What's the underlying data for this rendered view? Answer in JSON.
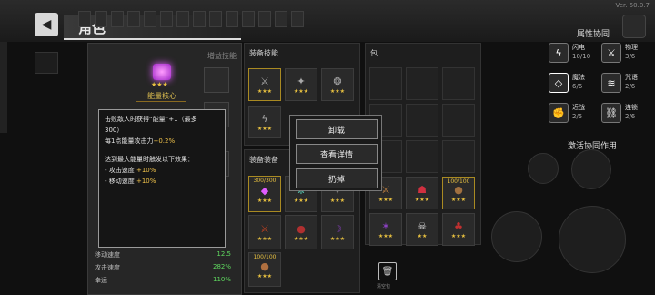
{
  "header": {
    "back_icon": "back-arrow-icon",
    "title": "角色",
    "version": "Ver. 50.0.7"
  },
  "character_panel": {
    "bonus_skill_label": "增益技能",
    "core": {
      "name": "能量核心",
      "icon": "energy-core-icon",
      "stars": "★★★"
    },
    "tooltip": {
      "line1": "击败敌人时获得“能量”+1（最多",
      "line2": "300）",
      "line3a": "每1点能量攻击力",
      "line3b": "+0.2%",
      "line4": "达到最大能量时触发以下效果：",
      "line5a": "- 攻击速度 ",
      "line5b": "+10%",
      "line6a": "- 移动速度 ",
      "line6b": "+10%"
    },
    "stats": [
      {
        "label": "移动速度",
        "value": "12.5"
      },
      {
        "label": "攻击速度",
        "value": "282%"
      },
      {
        "label": "幸运",
        "value": "110%"
      }
    ]
  },
  "equip_skill": {
    "label": "装备技能"
  },
  "equip_gear": {
    "label": "装备装备",
    "energy_count": "300/300",
    "count_a": "100/100"
  },
  "bag": {
    "label": "包",
    "count_b": "100/100"
  },
  "context_menu": {
    "unequip": "卸载",
    "details": "查看详情",
    "discard": "扔掉"
  },
  "trash": {
    "label": "清空包"
  },
  "synergy": {
    "title": "属性协同",
    "activate_label": "激活协同作用",
    "items": [
      {
        "name": "闪电",
        "count": "10/10",
        "icon": "lightning-icon"
      },
      {
        "name": "物理",
        "count": "3/6",
        "icon": "sword-icon"
      },
      {
        "name": "魔法",
        "count": "6/6",
        "icon": "diamond-icon"
      },
      {
        "name": "咒语",
        "count": "2/6",
        "icon": "curse-icon"
      },
      {
        "name": "近战",
        "count": "2/5",
        "icon": "fist-icon"
      },
      {
        "name": "连锁",
        "count": "2/6",
        "icon": "chain-icon"
      }
    ]
  }
}
